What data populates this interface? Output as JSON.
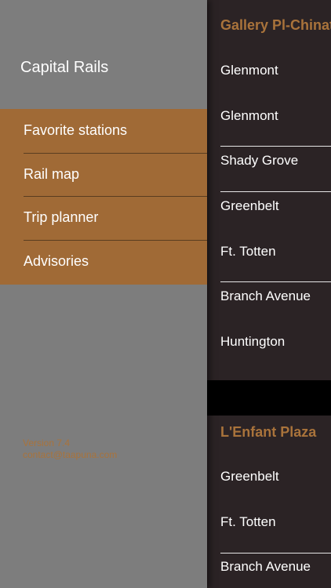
{
  "app": {
    "title": "Capital Rails",
    "version": "Version 7.4",
    "contact": "contact@taapuna.com"
  },
  "menu": {
    "items": [
      {
        "label": "Favorite stations"
      },
      {
        "label": "Rail map"
      },
      {
        "label": "Trip planner"
      },
      {
        "label": "Advisories"
      }
    ]
  },
  "stations": [
    {
      "name": "Gallery Pl-Chinatown",
      "destinations": [
        "Glenmont",
        "Glenmont",
        "Shady Grove",
        "Greenbelt",
        "Ft. Totten",
        "Branch Avenue",
        "Huntington"
      ]
    },
    {
      "name": "L'Enfant Plaza",
      "destinations": [
        "Greenbelt",
        "Ft. Totten",
        "Branch Avenue"
      ]
    }
  ],
  "colors": {
    "accent": "#a06a36",
    "accent_text": "#a9733b",
    "drawer_bg": "#7d7d7d",
    "panel_bg": "#2b2325"
  }
}
